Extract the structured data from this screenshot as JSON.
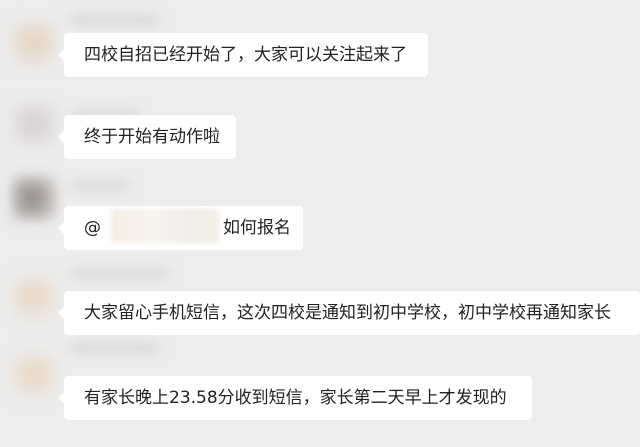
{
  "colors": {
    "background": "#ededed",
    "bubble": "#ffffff",
    "text": "#222222"
  },
  "messages": [
    {
      "text": "四校自招已经开始了，大家可以关注起来了"
    },
    {
      "text": "终于开始有动作啦"
    },
    {
      "at": "@",
      "text": "如何报名"
    },
    {
      "text": "大家留心手机短信，这次四校是通知到初中学校，初中学校再通知家长"
    },
    {
      "text": "有家长晚上23.58分收到短信，家长第二天早上才发现的"
    }
  ]
}
